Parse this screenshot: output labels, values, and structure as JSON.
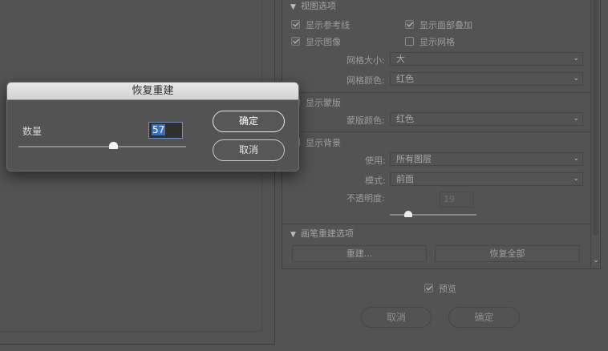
{
  "dialog": {
    "title": "恢复重建",
    "amount_label": "数量",
    "amount_value": "57",
    "amount_slider_fraction": 0.57,
    "ok_label": "确定",
    "cancel_label": "取消"
  },
  "view_options": {
    "title": "视图选项",
    "show_mesh": "显示参考线",
    "show_face_overlay": "显示面部叠加",
    "show_image": "显示图像",
    "show_grid": "显示网格",
    "grid_size_label": "网格大小:",
    "grid_size_value": "大",
    "grid_color_label": "网格颜色:",
    "grid_color_value": "红色"
  },
  "mask": {
    "show_mask": "显示蒙版",
    "mask_color_label": "蒙版颜色:",
    "mask_color_value": "红色"
  },
  "backdrop": {
    "show_backdrop": "显示背景",
    "use_label": "使用:",
    "use_value": "所有图层",
    "mode_label": "模式:",
    "mode_value": "前面",
    "opacity_label": "不透明度:",
    "opacity_value": "19"
  },
  "brush_reconstruct": {
    "title": "画笔重建选项",
    "reconstruct_button": "重建...",
    "restore_all_button": "恢复全部"
  },
  "footer": {
    "preview_label": "预览",
    "cancel_label": "取消",
    "ok_label": "确定"
  }
}
